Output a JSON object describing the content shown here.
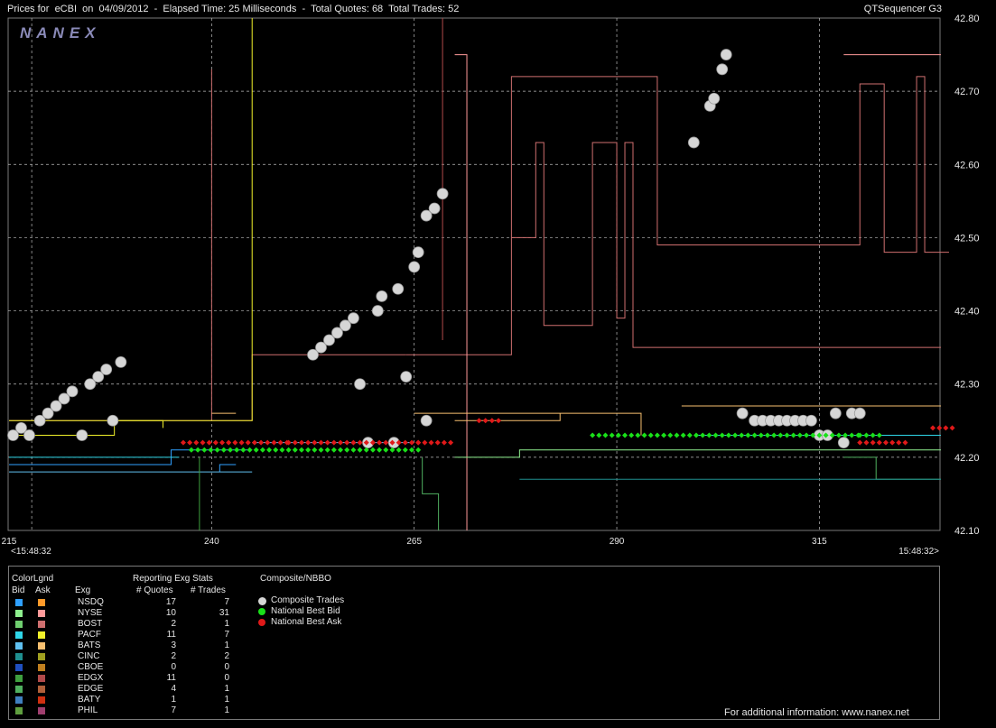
{
  "header": {
    "left": "Prices for  eCBI  on  04/09/2012  -  Elapsed Time: 25 Milliseconds  -  Total Quotes: 68  Total Trades: 52",
    "right": "QTSequencer G3"
  },
  "logo": "NANEX",
  "chart_data": {
    "type": "scatter",
    "xlim": [
      215,
      330
    ],
    "ylim": [
      42.1,
      42.8
    ],
    "x_ticks": [
      "215",
      "240",
      "265",
      "290",
      "315"
    ],
    "y_ticks": [
      "42.10",
      "42.20",
      "42.30",
      "42.40",
      "42.50",
      "42.60",
      "42.70",
      "42.80"
    ],
    "time_left": "<15:48:32",
    "time_right": "15:48:32>",
    "grid": "dashed",
    "series": [
      {
        "name": "Composite Trades",
        "color": "#d6d6d6",
        "points": [
          [
            215.5,
            42.23
          ],
          [
            216.5,
            42.24
          ],
          [
            217.5,
            42.23
          ],
          [
            218.8,
            42.25
          ],
          [
            219.8,
            42.26
          ],
          [
            220.8,
            42.27
          ],
          [
            221.8,
            42.28
          ],
          [
            222.8,
            42.29
          ],
          [
            224.0,
            42.23
          ],
          [
            225.0,
            42.3
          ],
          [
            226.0,
            42.31
          ],
          [
            227.0,
            42.32
          ],
          [
            227.8,
            42.25
          ],
          [
            228.8,
            42.33
          ],
          [
            252.5,
            42.34
          ],
          [
            253.5,
            42.35
          ],
          [
            254.5,
            42.36
          ],
          [
            255.5,
            42.37
          ],
          [
            256.5,
            42.38
          ],
          [
            257.5,
            42.39
          ],
          [
            258.3,
            42.3
          ],
          [
            259.3,
            42.22
          ],
          [
            260.5,
            42.4
          ],
          [
            261.0,
            42.42
          ],
          [
            262.5,
            42.22
          ],
          [
            263.0,
            42.43
          ],
          [
            264.0,
            42.31
          ],
          [
            265.0,
            42.46
          ],
          [
            265.5,
            42.48
          ],
          [
            266.5,
            42.25
          ],
          [
            266.5,
            42.53
          ],
          [
            267.5,
            42.54
          ],
          [
            268.5,
            42.56
          ],
          [
            299.5,
            42.63
          ],
          [
            301.5,
            42.68
          ],
          [
            302.0,
            42.69
          ],
          [
            303.0,
            42.73
          ],
          [
            303.5,
            42.75
          ],
          [
            305.5,
            42.26
          ],
          [
            307.0,
            42.25
          ],
          [
            308.0,
            42.25
          ],
          [
            309.0,
            42.25
          ],
          [
            310.0,
            42.25
          ],
          [
            311.0,
            42.25
          ],
          [
            312.0,
            42.25
          ],
          [
            313.0,
            42.25
          ],
          [
            314.0,
            42.25
          ],
          [
            315.0,
            42.23
          ],
          [
            316.0,
            42.23
          ],
          [
            317.0,
            42.26
          ],
          [
            318.0,
            42.22
          ],
          [
            319.0,
            42.26
          ],
          [
            320.0,
            42.26
          ]
        ]
      },
      {
        "name": "National Best Bid",
        "color": "#19e019",
        "points": [
          [
            236.5,
            42.2
          ],
          [
            237.5,
            42.21
          ],
          [
            265.5,
            42.21
          ],
          [
            273.0,
            42.22
          ],
          [
            287.0,
            42.23
          ],
          [
            320.0,
            42.23
          ],
          [
            323.0,
            42.23
          ],
          [
            326.0,
            42.24
          ]
        ],
        "dot_spacing": 0.8
      },
      {
        "name": "National Best Ask",
        "color": "#e01919",
        "points": [
          [
            236.5,
            42.22
          ],
          [
            249.5,
            42.22
          ],
          [
            265.5,
            42.22
          ],
          [
            269.5,
            42.22
          ],
          [
            273.0,
            42.25
          ],
          [
            275.5,
            42.25
          ],
          [
            320.0,
            42.22
          ],
          [
            326.0,
            42.22
          ],
          [
            329.0,
            42.24
          ],
          [
            332.0,
            42.24
          ]
        ],
        "dot_spacing": 0.8
      }
    ]
  },
  "legend": {
    "color_legend_title": "ColorLgnd",
    "bid_label": "Bid",
    "ask_label": "Ask",
    "exg_label": "Exg",
    "stats_title": "Reporting Exg Stats",
    "quotes_label": "# Quotes",
    "trades_label": "# Trades",
    "composite_title": "Composite/NBBO",
    "exchanges": [
      {
        "name": "NSDQ",
        "bid": "#2fa0ff",
        "ask": "#ff9a2a",
        "quotes": "17",
        "trades": "7"
      },
      {
        "name": "NYSE",
        "bid": "#8ff08f",
        "ask": "#ff9a9a",
        "quotes": "10",
        "trades": "31"
      },
      {
        "name": "BOST",
        "bid": "#6fcf6f",
        "ask": "#cf6f6f",
        "quotes": "2",
        "trades": "1"
      },
      {
        "name": "PACF",
        "bid": "#2fd6e8",
        "ask": "#f0f02a",
        "quotes": "11",
        "trades": "7"
      },
      {
        "name": "BATS",
        "bid": "#5fc0f0",
        "ask": "#f8c070",
        "quotes": "3",
        "trades": "1"
      },
      {
        "name": "CINC",
        "bid": "#1f8f8f",
        "ask": "#a0a020",
        "quotes": "2",
        "trades": "2"
      },
      {
        "name": "CBOE",
        "bid": "#1f4fbf",
        "ask": "#bf7f1f",
        "quotes": "0",
        "trades": "0"
      },
      {
        "name": "EDGX",
        "bid": "#3f9f3f",
        "ask": "#b04a4a",
        "quotes": "11",
        "trades": "0"
      },
      {
        "name": "EDGE",
        "bid": "#4faf5f",
        "ask": "#b0603a",
        "quotes": "4",
        "trades": "1"
      },
      {
        "name": "BATY",
        "bid": "#3f7fbf",
        "ask": "#d03010",
        "quotes": "1",
        "trades": "1"
      },
      {
        "name": "PHIL",
        "bid": "#5f9f3f",
        "ask": "#a03f6f",
        "quotes": "7",
        "trades": "1"
      }
    ],
    "composite_items": [
      {
        "label": "Composite Trades",
        "color": "#d6d6d6"
      },
      {
        "label": "National Best Bid",
        "color": "#19e019"
      },
      {
        "label": "National Best Ask",
        "color": "#e01919"
      }
    ],
    "footer": "For additional information: www.nanex.net"
  }
}
